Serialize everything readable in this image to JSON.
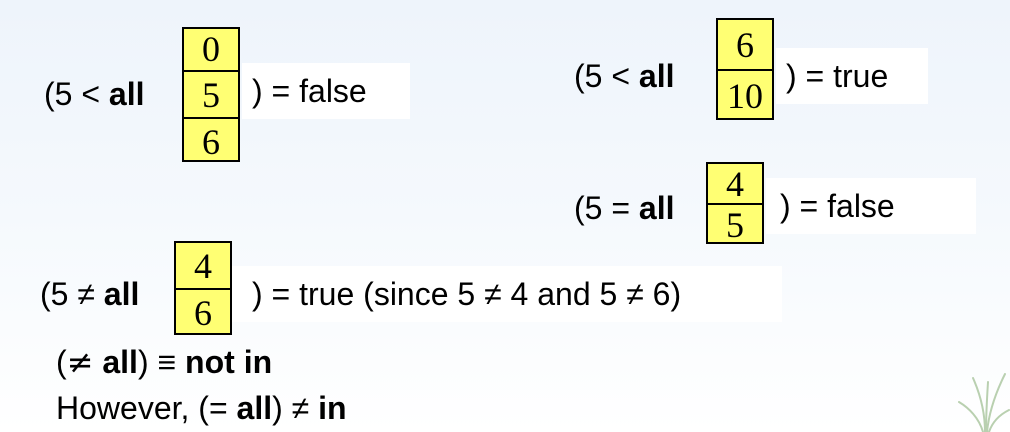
{
  "ex1": {
    "open": "(5 < ",
    "kw": "all",
    "close": ") = false",
    "values": [
      "0",
      "5",
      "6"
    ]
  },
  "ex2": {
    "open": "(5 < ",
    "kw": "all",
    "close": ") = true",
    "values": [
      "6",
      "10"
    ]
  },
  "ex3": {
    "open": "(5 = ",
    "kw": "all",
    "close": ") = false",
    "values": [
      "4",
      "5"
    ]
  },
  "ex4": {
    "open": "(5 ≠ ",
    "kw": "all",
    "close": ") = true (since 5 ≠ 4 and 5 ≠ 6)",
    "values": [
      "4",
      "6"
    ]
  },
  "line1": {
    "open": "(",
    "sym": "≠",
    "kw": " all",
    "rest": ") ≡ ",
    "kw2": "not in"
  },
  "line2": {
    "prefix": "However, (= ",
    "kw": "all",
    "rest": ") ≠ ",
    "kw2": "in"
  },
  "colors": {
    "cell_fill": "#ffff73",
    "background": "#eef4fb"
  }
}
